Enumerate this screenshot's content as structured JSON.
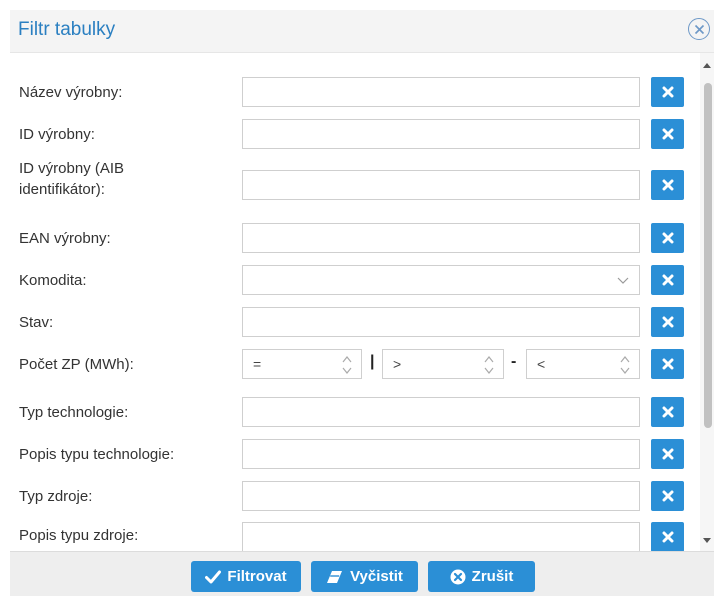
{
  "dialog": {
    "title": "Filtr tabulky"
  },
  "fields": [
    {
      "label": "Název výrobny",
      "colon": ":"
    },
    {
      "label": "ID výrobny",
      "colon": ":"
    },
    {
      "label_line1": "ID výrobny (AIB",
      "label_line2": "identifikátor):"
    },
    {
      "label": "EAN výrobny",
      "colon": ":"
    },
    {
      "label": "Komodita",
      "colon": ":"
    },
    {
      "label": "Stav",
      "colon": ":"
    },
    {
      "label": "Počet ZP (MWh)",
      "colon": ":"
    },
    {
      "label": "Typ technologie",
      "colon": ":"
    },
    {
      "label": "Popis typu technologie",
      "colon": ":"
    },
    {
      "label": "Typ zdroje",
      "colon": ":"
    },
    {
      "label": "Popis typu zdroje",
      "colon": ":"
    }
  ],
  "labels": {
    "nazev": "Název výrobny:",
    "id": "ID výrobny:",
    "aib1": "ID výrobny (AIB",
    "aib2": "identifikátor):",
    "ean": "EAN výrobny:",
    "komodita": "Komodita:",
    "stav": "Stav:",
    "pocet": "Počet ZP (MWh):",
    "typtech": "Typ technologie:",
    "popistech": "Popis typu technologie:",
    "typzdroje": "Typ zdroje:",
    "popiszdroje": "Popis typu zdroje:"
  },
  "pocet": {
    "op_eq": "=",
    "sep_bar": "|",
    "op_gt": ">",
    "sep_dash": "-",
    "op_lt": "<"
  },
  "footer": {
    "filter_label": "Filtrovat",
    "clear_label": "Vyčistit",
    "cancel_label": "Zrušit"
  },
  "colors": {
    "accent": "#2b8fd6",
    "title": "#2a7fc1"
  }
}
